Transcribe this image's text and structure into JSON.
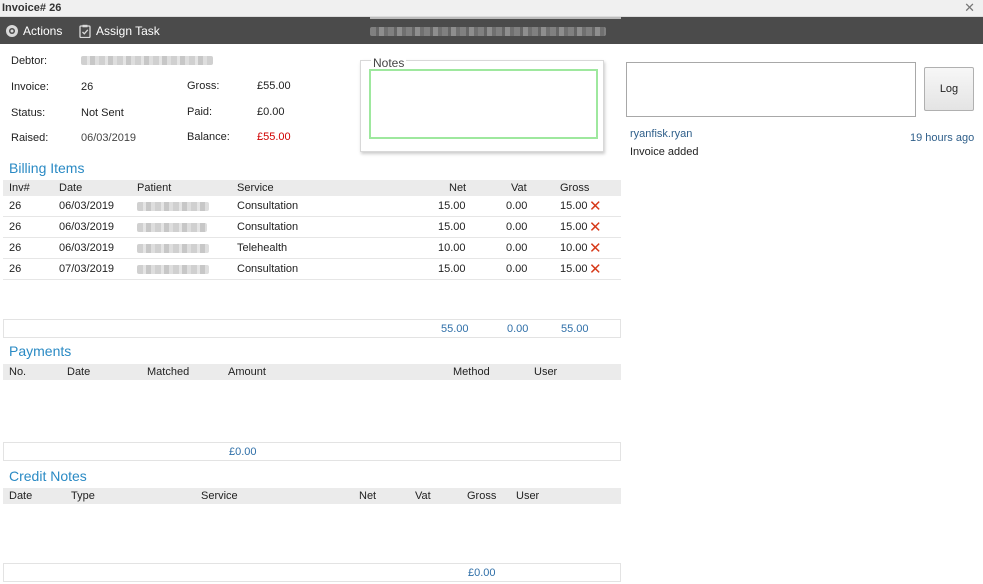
{
  "window": {
    "title": "Invoice# 26",
    "close_glyph": "✕"
  },
  "toolbar": {
    "actions_label": "Actions",
    "assign_label": "Assign Task"
  },
  "info": {
    "debtor_label": "Debtor:",
    "invoice_label": "Invoice:",
    "invoice_value": "26",
    "status_label": "Status:",
    "status_value": "Not Sent",
    "raised_label": "Raised:",
    "raised_value": "06/03/2019",
    "gross_label": "Gross:",
    "gross_value": "£55.00",
    "paid_label": "Paid:",
    "paid_value": "£0.00",
    "balance_label": "Balance:",
    "balance_value": "£55.00"
  },
  "notes": {
    "legend": "Notes"
  },
  "billing": {
    "title": "Billing Items",
    "headers": [
      "Inv#",
      "Date",
      "Patient",
      "Service",
      "Net",
      "Vat",
      "Gross"
    ],
    "rows": [
      {
        "inv": "26",
        "date": "06/03/2019",
        "service": "Consultation",
        "net": "15.00",
        "vat": "0.00",
        "gross": "15.00"
      },
      {
        "inv": "26",
        "date": "06/03/2019",
        "service": "Consultation",
        "net": "15.00",
        "vat": "0.00",
        "gross": "15.00"
      },
      {
        "inv": "26",
        "date": "06/03/2019",
        "service": "Telehealth",
        "net": "10.00",
        "vat": "0.00",
        "gross": "10.00"
      },
      {
        "inv": "26",
        "date": "07/03/2019",
        "service": "Consultation",
        "net": "15.00",
        "vat": "0.00",
        "gross": "15.00"
      }
    ],
    "delete_glyph": "✕",
    "totals": {
      "net": "55.00",
      "vat": "0.00",
      "gross": "55.00"
    }
  },
  "payments": {
    "title": "Payments",
    "headers": [
      "No.",
      "Date",
      "Matched",
      "Amount",
      "Method",
      "User"
    ],
    "total_amount": "£0.00"
  },
  "credit_notes": {
    "title": "Credit Notes",
    "headers": [
      "Date",
      "Type",
      "Service",
      "Net",
      "Vat",
      "Gross",
      "User"
    ],
    "total_gross": "£0.00"
  },
  "log": {
    "button_label": "Log",
    "entry_user": "ryanfisk.ryan",
    "entry_time": "19 hours ago",
    "entry_message": "Invoice added"
  },
  "colors": {
    "accent": "#2a8ac4",
    "toolbar": "#4b4b4b",
    "negative": "#d00000",
    "delete": "#d73a1a"
  }
}
